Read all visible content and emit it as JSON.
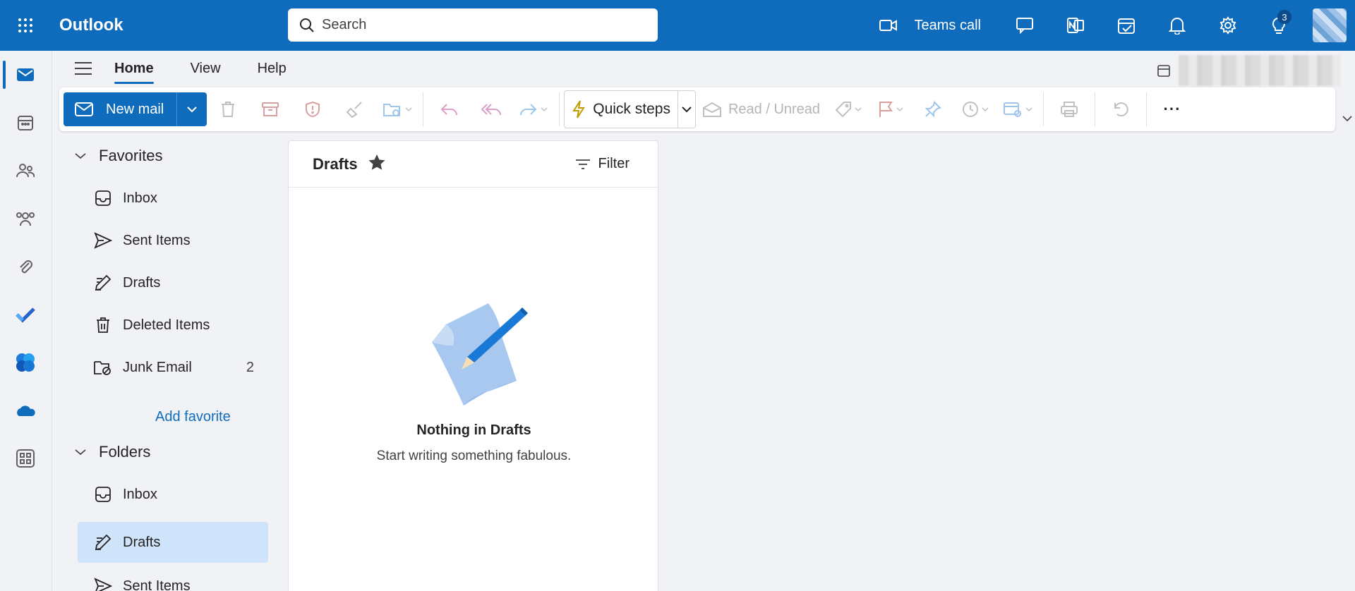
{
  "topbar": {
    "app_title": "Outlook",
    "search_placeholder": "Search",
    "teams_call_label": "Teams call",
    "notifications_badge": "3"
  },
  "ribbon_tabs": [
    "Home",
    "View",
    "Help"
  ],
  "toolbar": {
    "new_mail_label": "New mail",
    "quick_steps_label": "Quick steps",
    "read_unread_label": "Read / Unread",
    "more_label": "···"
  },
  "favorites": {
    "header": "Favorites",
    "items": [
      {
        "label": "Inbox",
        "count": ""
      },
      {
        "label": "Sent Items",
        "count": ""
      },
      {
        "label": "Drafts",
        "count": ""
      },
      {
        "label": "Deleted Items",
        "count": ""
      },
      {
        "label": "Junk Email",
        "count": "2"
      }
    ],
    "add_favorite": "Add favorite"
  },
  "folders": {
    "header": "Folders",
    "items": [
      {
        "label": "Inbox"
      },
      {
        "label": "Drafts"
      },
      {
        "label": "Sent Items"
      }
    ]
  },
  "message_list": {
    "title": "Drafts",
    "filter_label": "Filter",
    "empty_title": "Nothing in Drafts",
    "empty_subtitle": "Start writing something fabulous."
  },
  "colors": {
    "brand": "#0f6cbd",
    "selected": "#cfe4fa"
  }
}
